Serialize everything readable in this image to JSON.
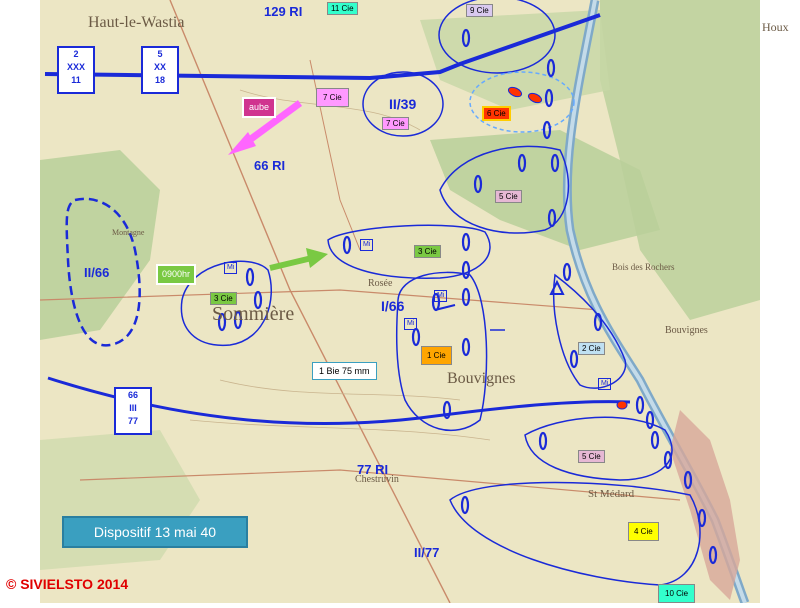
{
  "map": {
    "caption": "Dispositif  13 mai 40",
    "copyright": "© SIVIELSTO 2014",
    "battery": "1 Bie 75 mm",
    "time_label": "0900hr",
    "dawn_label": "aube"
  },
  "towns": [
    "Haut-le-Wastia",
    "Houx",
    "Sommière",
    "Bouvignes",
    "Chestruvin",
    "Montagne",
    "Rosée",
    "Bois des Rochers",
    "Bouvignes",
    "St Médard"
  ],
  "units": {
    "ri129": "129 RI",
    "ri66": "66 RI",
    "ri77": "77 RI",
    "bn_2_39": "II/39",
    "bn_2_66": "II/66",
    "bn_1_66": "I/66",
    "bn_2_77": "II/77"
  },
  "corps_markers": [
    {
      "lines": [
        "2",
        "XXX",
        "11"
      ]
    },
    {
      "lines": [
        "5",
        "XX",
        "18"
      ]
    },
    {
      "lines": [
        "66",
        "III",
        "77"
      ]
    }
  ],
  "companies": {
    "c11": "11 Cie",
    "c9": "9 Cie",
    "c7_top": "7 Cie",
    "c7": "7 Cie",
    "c6": "6 Cie",
    "c5_top": "5 Cie",
    "c3_left": "3 Cie",
    "c3_right": "3 Cie",
    "c1": "1 Cie",
    "c2": "2 Cie",
    "c5_bottom": "5 Cie",
    "c4": "4 Cie",
    "c10": "10 Cie"
  },
  "mi_labels": [
    "Mi",
    "Mi",
    "Mi",
    "Mi",
    "Mi"
  ],
  "colors": {
    "blue": "#1a2ad8",
    "magenta": "#ff66ff",
    "green_label": "#7ac943",
    "orange_label": "#ffa500",
    "red_label": "#ff3300",
    "yellow_label": "#ffff00",
    "cyan_label": "#33ffcc",
    "map_paper": "#ece6c4",
    "forest": "#b9cf9a",
    "copyright_red": "#e00000"
  }
}
